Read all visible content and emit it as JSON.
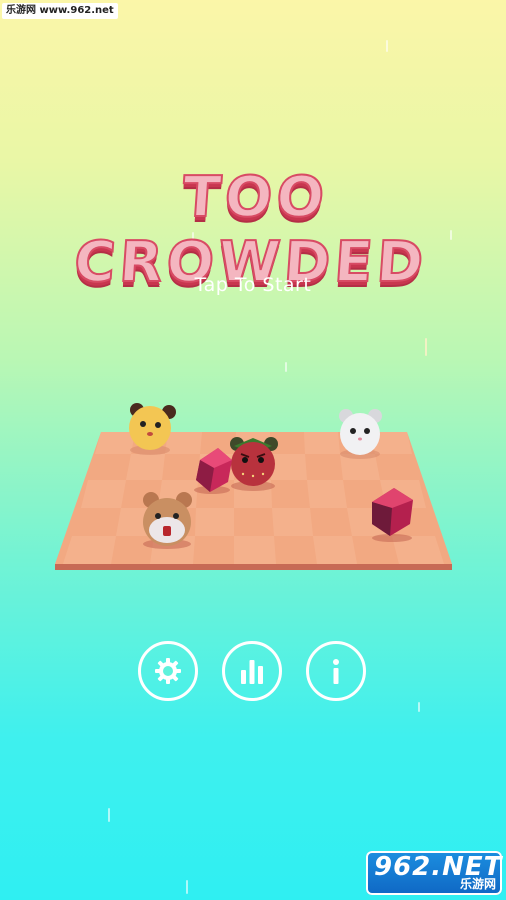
{
  "watermark": {
    "top_text": "乐游网 www.962.net",
    "bottom_big": "962.NET",
    "bottom_small": "乐游网"
  },
  "title": "TOO CROWDED",
  "prompt": "Tap To Start",
  "buttons": [
    {
      "name": "settings",
      "icon": "gear-icon"
    },
    {
      "name": "leaderboard",
      "icon": "bar-chart-icon"
    },
    {
      "name": "info",
      "icon": "info-icon"
    }
  ],
  "board": {
    "characters": [
      {
        "name": "yellow-hamster",
        "color": "#f3c653"
      },
      {
        "name": "white-hamster",
        "color": "#f1f1f3"
      },
      {
        "name": "strawberry-hamster",
        "color": "#b8323d"
      },
      {
        "name": "brown-hamster",
        "color": "#c98f62"
      }
    ],
    "gems": [
      {
        "name": "red-gem",
        "color": "#c8285a"
      },
      {
        "name": "red-gem",
        "color": "#b4204e"
      }
    ]
  }
}
